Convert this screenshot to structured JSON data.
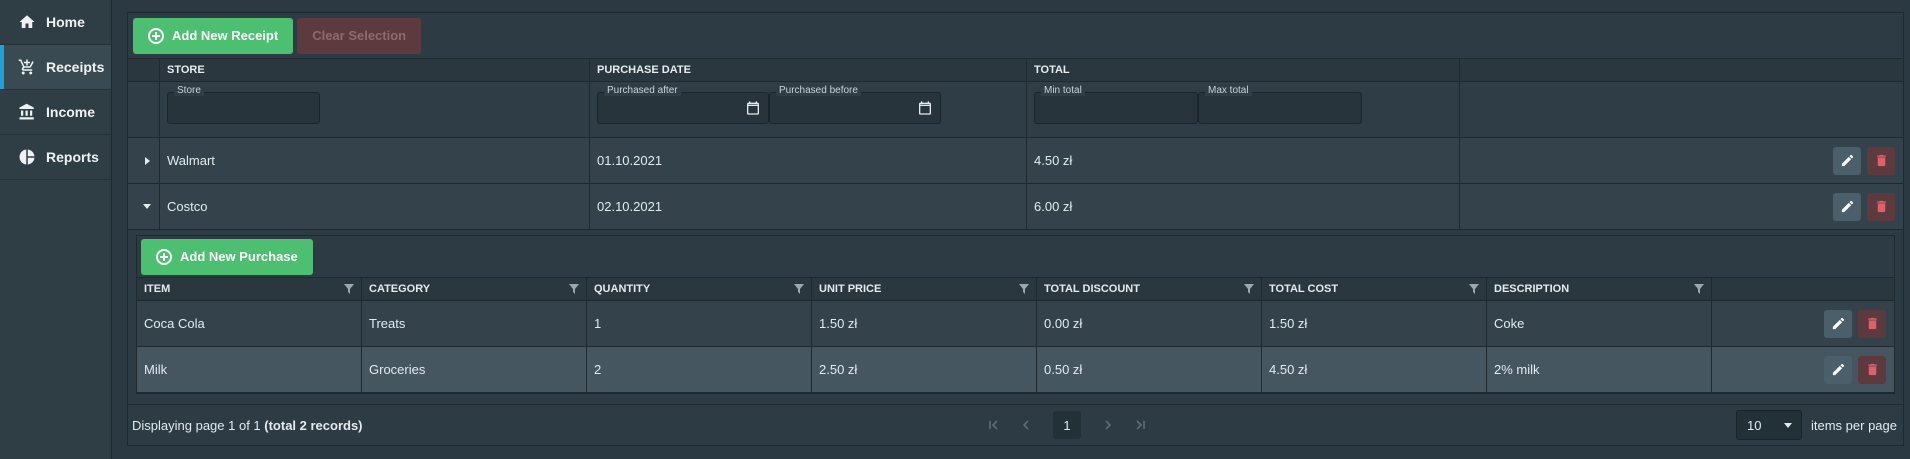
{
  "sidebar": {
    "items": [
      {
        "label": "Home",
        "icon": "home-icon"
      },
      {
        "label": "Receipts",
        "icon": "cart-icon",
        "active": true
      },
      {
        "label": "Income",
        "icon": "bank-icon"
      },
      {
        "label": "Reports",
        "icon": "pie-chart-icon"
      }
    ]
  },
  "toolbar": {
    "add_receipt_label": "Add New Receipt",
    "clear_selection_label": "Clear Selection"
  },
  "receipts": {
    "columns": [
      "STORE",
      "PURCHASE DATE",
      "TOTAL"
    ],
    "filters": {
      "store": "Store",
      "purchased_after": "Purchased after",
      "purchased_before": "Purchased before",
      "min_total": "Min total",
      "max_total": "Max total"
    },
    "rows": [
      {
        "store": "Walmart",
        "date": "01.10.2021",
        "total": "4.50 zł",
        "expanded": false
      },
      {
        "store": "Costco",
        "date": "02.10.2021",
        "total": "6.00 zł",
        "expanded": true
      }
    ]
  },
  "purchases": {
    "add_label": "Add New Purchase",
    "columns": [
      "ITEM",
      "CATEGORY",
      "QUANTITY",
      "UNIT PRICE",
      "TOTAL DISCOUNT",
      "TOTAL COST",
      "DESCRIPTION"
    ],
    "rows": [
      [
        "Coca Cola",
        "Treats",
        "1",
        "1.50 zł",
        "0.00 zł",
        "1.50 zł",
        "Coke"
      ],
      [
        "Milk",
        "Groceries",
        "2",
        "2.50 zł",
        "0.50 zł",
        "4.50 zł",
        "2% milk"
      ]
    ]
  },
  "paginator": {
    "info_prefix": "Displaying page 1 of 1 ",
    "info_bold": "(total 2 records)",
    "current_page": "1",
    "per_page_value": "10",
    "per_page_label": "items per page"
  },
  "colors": {
    "accent": "#1fa0d6",
    "primary_button": "#4cbf71",
    "danger_button": "#5c3a3d"
  }
}
